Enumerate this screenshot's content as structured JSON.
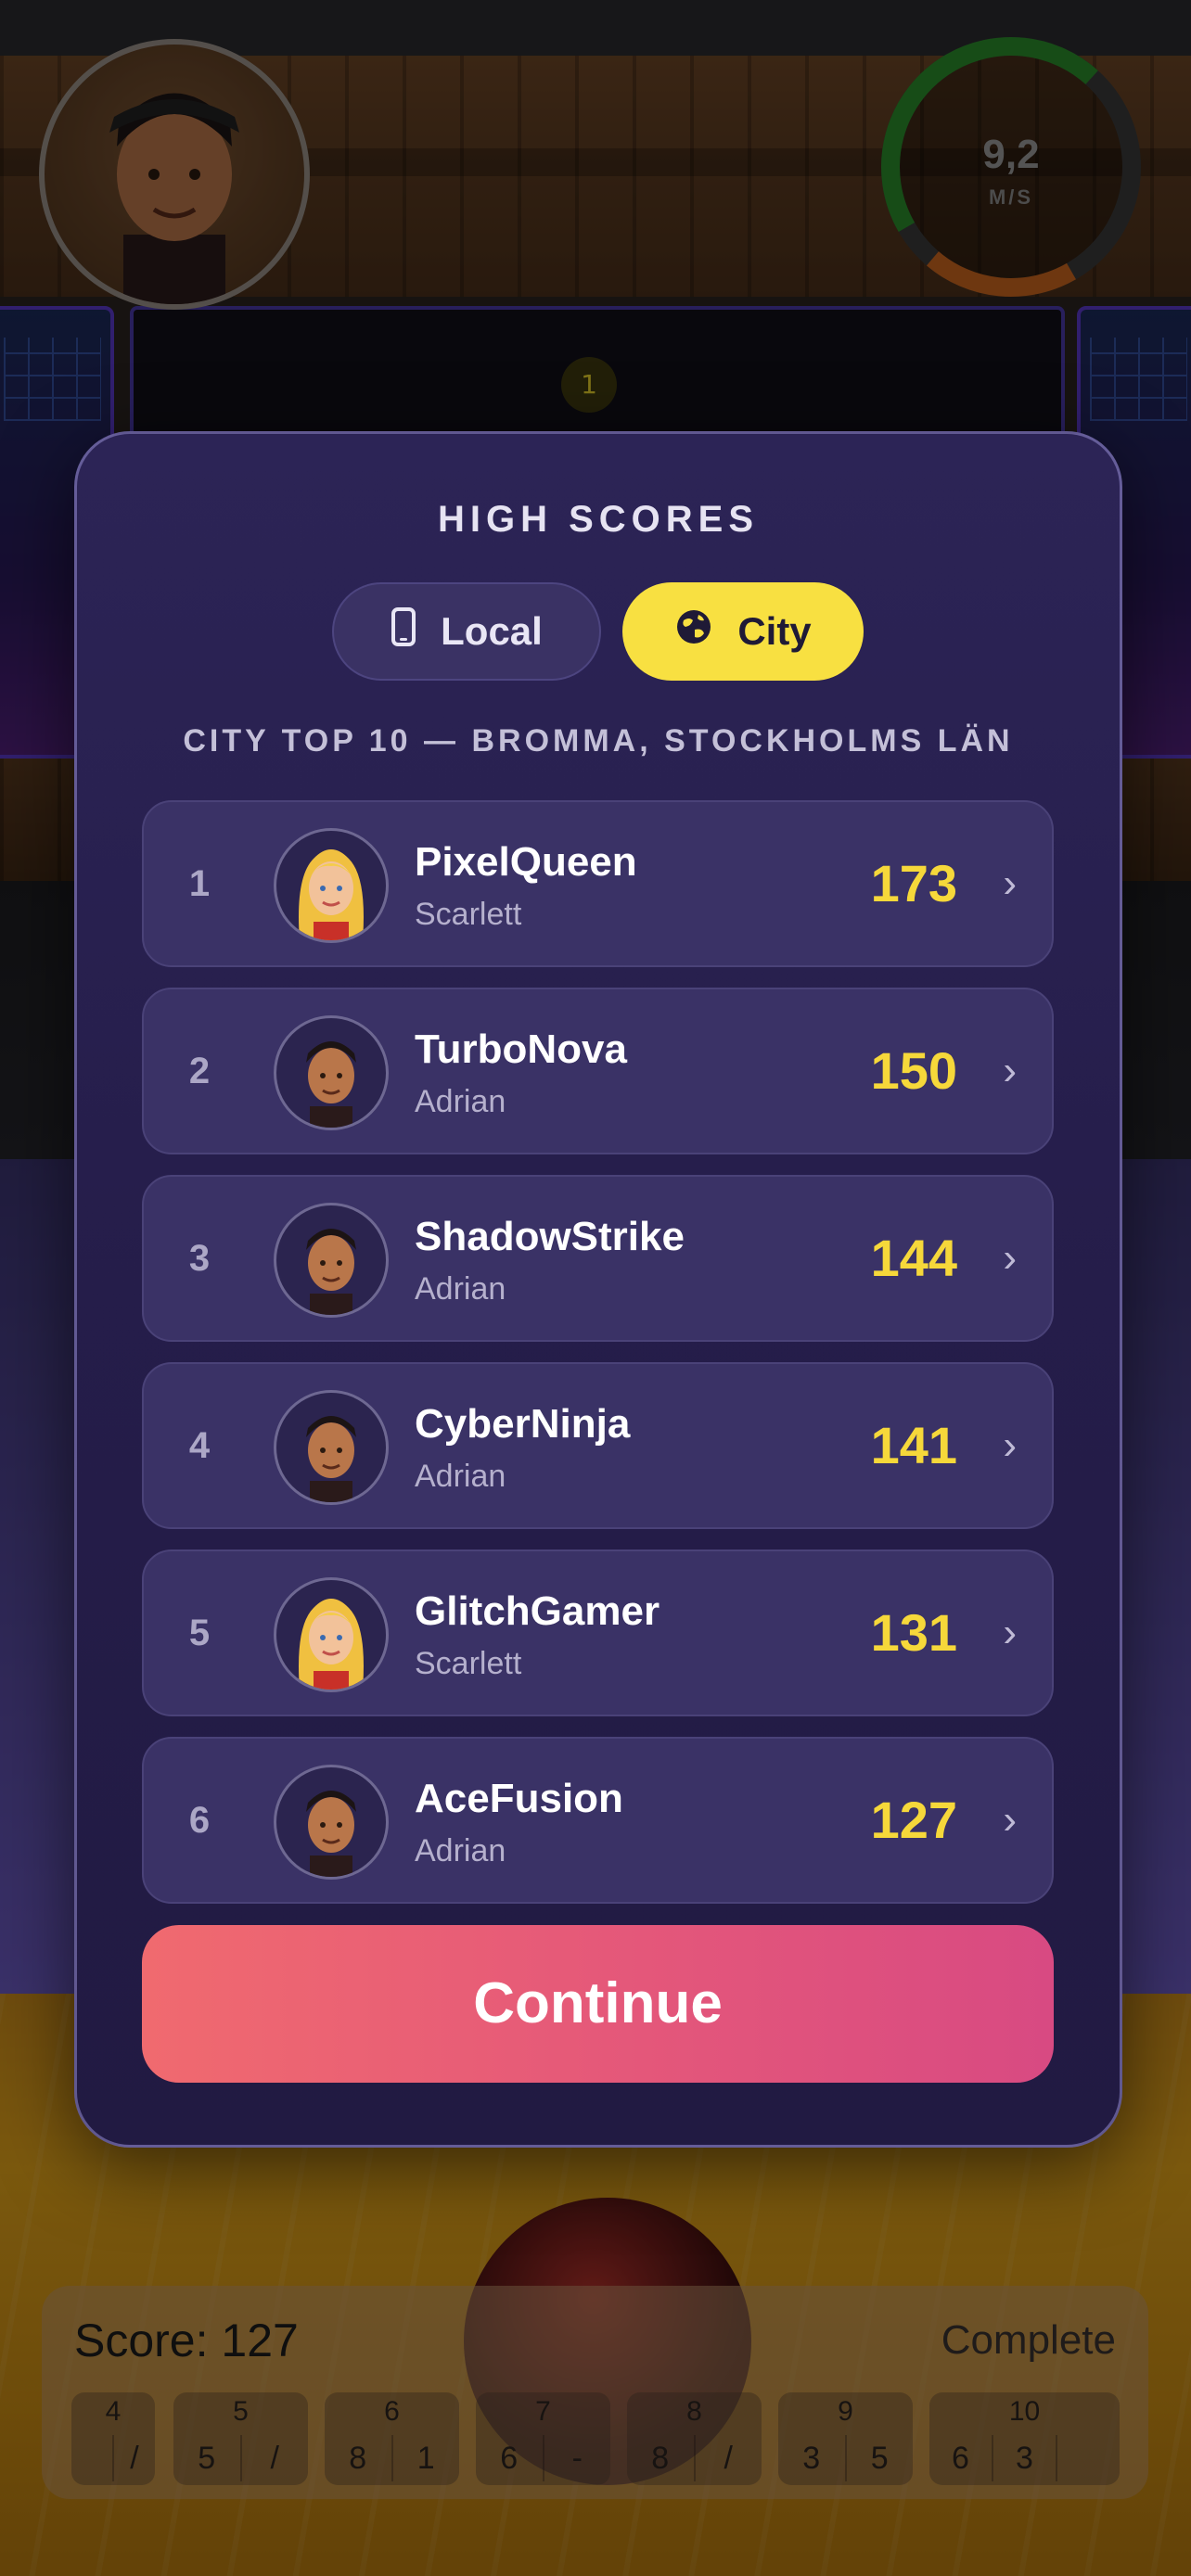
{
  "hud": {
    "speed_value": "9,2",
    "speed_unit": "M/S",
    "speed_fraction": 0.75,
    "frame_indicator": "1"
  },
  "modal": {
    "title": "HIGH SCORES",
    "tabs": [
      {
        "label": "Local",
        "icon": "phone-icon",
        "selected": false
      },
      {
        "label": "City",
        "icon": "globe-icon",
        "selected": true
      }
    ],
    "subtitle": "CITY TOP 10 — BROMMA, STOCKHOLMS LÄN",
    "rows": [
      {
        "rank": "1",
        "name": "PixelQueen",
        "character": "Scarlett",
        "score": "173"
      },
      {
        "rank": "2",
        "name": "TurboNova",
        "character": "Adrian",
        "score": "150"
      },
      {
        "rank": "3",
        "name": "ShadowStrike",
        "character": "Adrian",
        "score": "144"
      },
      {
        "rank": "4",
        "name": "CyberNinja",
        "character": "Adrian",
        "score": "141"
      },
      {
        "rank": "5",
        "name": "GlitchGamer",
        "character": "Scarlett",
        "score": "131"
      },
      {
        "rank": "6",
        "name": "AceFusion",
        "character": "Adrian",
        "score": "127"
      }
    ],
    "continue_label": "Continue"
  },
  "scorecard": {
    "score_label": "Score: 127",
    "status": "Complete",
    "frames": [
      {
        "num": "4",
        "rolls": [
          "",
          "/"
        ]
      },
      {
        "num": "5",
        "rolls": [
          "5",
          "/"
        ]
      },
      {
        "num": "6",
        "rolls": [
          "8",
          "1"
        ]
      },
      {
        "num": "7",
        "rolls": [
          "6",
          "-"
        ]
      },
      {
        "num": "8",
        "rolls": [
          "8",
          "/"
        ]
      },
      {
        "num": "9",
        "rolls": [
          "3",
          "5"
        ]
      },
      {
        "num": "10",
        "rolls": [
          "6",
          "3",
          ""
        ]
      }
    ]
  },
  "colors": {
    "accent_yellow": "#f8e041",
    "score_yellow": "#f6d83a",
    "continue_start": "#f06a6f",
    "continue_end": "#d84a82",
    "modal_bg": "#2c2456",
    "speed_ring_green": "#2a8a2a",
    "speed_ring_orange": "#c8641e"
  }
}
